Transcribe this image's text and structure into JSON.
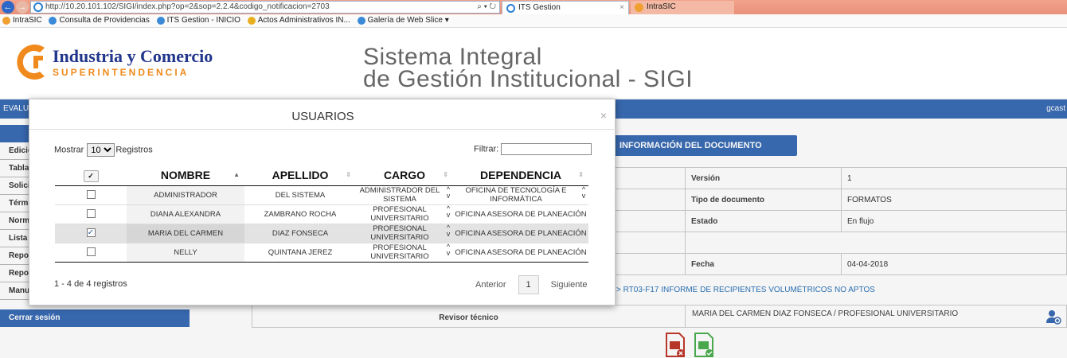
{
  "browser": {
    "address": "http://10.20.101.102/SIGI/index.php?op=2&sop=2.2.4&codigo_notificacion=2703",
    "address_tools": "⌕ ▾ ↻",
    "tabs": [
      {
        "label": "ITS Gestion"
      },
      {
        "label": "IntraSIC"
      }
    ],
    "favorites": [
      "IntraSIC",
      "Consulta de Providencias",
      "ITS Gestion - INICIO",
      "Actos Administrativos IN...",
      "Galería de Web Slice ▾"
    ]
  },
  "header": {
    "logo_line1": "Industria y Comercio",
    "logo_line2": "SUPERINTENDENCIA",
    "system_title_line1": "Sistema Integral",
    "system_title_line2": "de Gestión Institucional - SIGI",
    "bar_left": "EVALU",
    "bar_right": "gcast"
  },
  "sidebar": {
    "items": [
      "Edició",
      "Tabla",
      "Solici",
      "Térm",
      "Norm",
      "Lista",
      "Repo",
      "Repo",
      "Manu"
    ],
    "logout": "Cerrar sesión"
  },
  "document": {
    "info_button": "INFORMACIÓN DEL DOCUMENTO",
    "rows": [
      {
        "label": "Versión",
        "value": "1"
      },
      {
        "label": "Tipo de documento",
        "value": "FORMATOS"
      },
      {
        "label": "Estado",
        "value": "En flujo"
      },
      {
        "label": "",
        "value": ""
      },
      {
        "label": "Fecha",
        "value": "04-04-2018"
      }
    ],
    "link": "> RT03-F17 INFORME DE RECIPIENTES VOLUMÉTRICOS NO APTOS",
    "reviewer_label": "Revisor técnico",
    "reviewer_value": "MARIA DEL CARMEN DIAZ FONSECA / PROFESIONAL UNIVERSITARIO"
  },
  "modal": {
    "title": "USUARIOS",
    "close": "×",
    "show_label": "Mostrar",
    "show_value": "10",
    "records_label": "Registros",
    "filter_label": "Filtrar:",
    "filter_value": "",
    "columns": [
      "NOMBRE",
      "APELLIDO",
      "CARGO",
      "DEPENDENCIA"
    ],
    "rows": [
      {
        "checked": false,
        "nombre": "ADMINISTRADOR",
        "apellido": "DEL SISTEMA",
        "cargo": "ADMINISTRADOR DEL SISTEMA",
        "dependencia": "OFICINA DE TECNOLOGÍA E INFORMÁTICA"
      },
      {
        "checked": false,
        "nombre": "DIANA ALEXANDRA",
        "apellido": "ZAMBRANO ROCHA",
        "cargo": "PROFESIONAL UNIVERSITARIO",
        "dependencia": "OFICINA ASESORA DE PLANEACIÓN"
      },
      {
        "checked": true,
        "nombre": "MARIA DEL CARMEN",
        "apellido": "DIAZ FONSECA",
        "cargo": "PROFESIONAL UNIVERSITARIO",
        "dependencia": "OFICINA ASESORA DE PLANEACIÓN"
      },
      {
        "checked": false,
        "nombre": "NELLY",
        "apellido": "QUINTANA JEREZ",
        "cargo": "PROFESIONAL UNIVERSITARIO",
        "dependencia": "OFICINA ASESORA DE PLANEACIÓN"
      }
    ],
    "info": "1 - 4 de 4 registros",
    "prev": "Anterior",
    "page": "1",
    "next": "Siguiente"
  },
  "colors": {
    "brand_blue": "#3a6cb4",
    "logo_navy": "#22368c",
    "logo_orange": "#f08a1c",
    "link": "#2b73b8"
  }
}
